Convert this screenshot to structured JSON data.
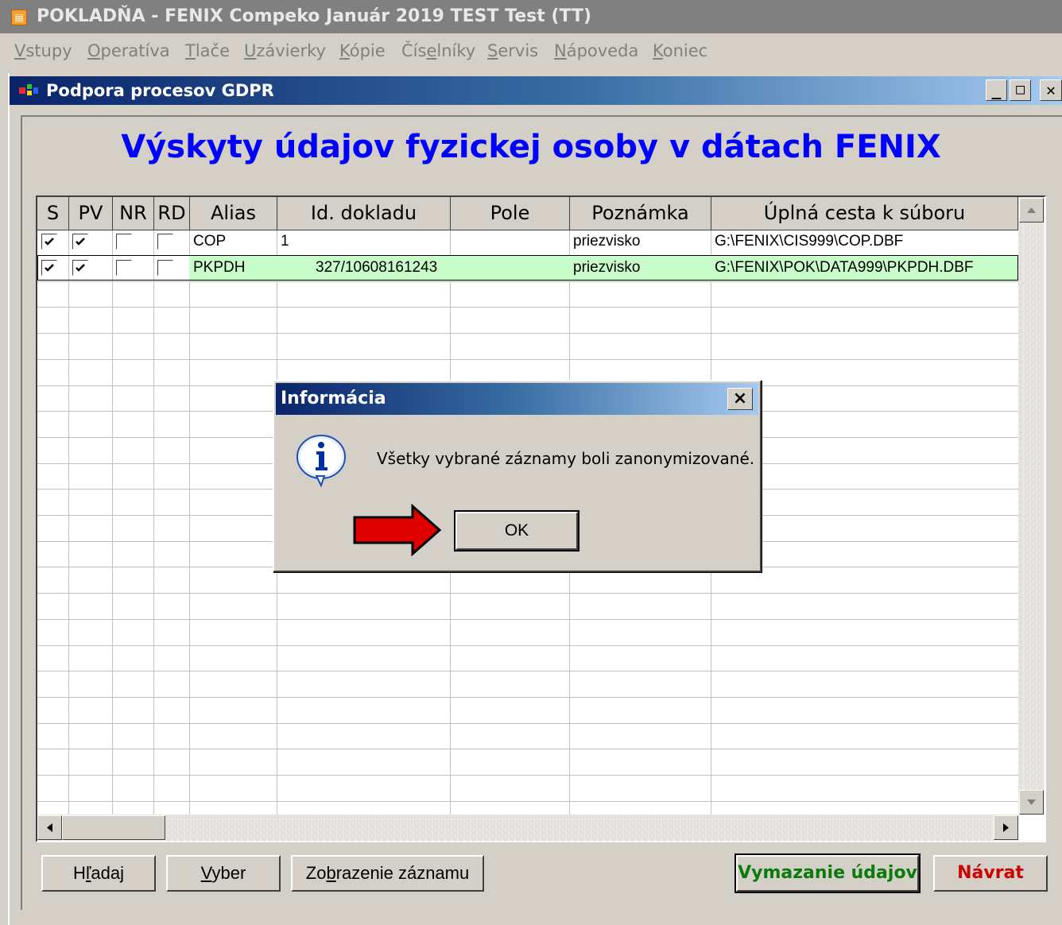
{
  "app": {
    "title": "POKLADŇA - FENIX Compeko  Január 2019  TEST Test  (TT)"
  },
  "menu": {
    "items": [
      {
        "underline": "V",
        "rest": "stupy"
      },
      {
        "underline": "O",
        "rest": "peratíva"
      },
      {
        "underline": "T",
        "rest": "lače"
      },
      {
        "underline": "U",
        "rest": "závierky"
      },
      {
        "underline": "K",
        "rest": "ópie"
      },
      {
        "pre": "Čís",
        "underline": "e",
        "rest": "lníky"
      },
      {
        "underline": "S",
        "rest": "ervis"
      },
      {
        "underline": "N",
        "rest": "ápoveda"
      },
      {
        "underline": "K",
        "rest": "oniec"
      }
    ]
  },
  "window": {
    "title": "Podpora procesov GDPR",
    "heading": "Výskyty údajov fyzickej osoby v dátach FENIX"
  },
  "grid": {
    "columns": [
      "S",
      "PV",
      "NR",
      "RD",
      "Alias",
      "Id. dokladu",
      "Pole",
      "Poznámka",
      "Úplná cesta k súboru"
    ],
    "rows": [
      {
        "s": true,
        "pv": true,
        "nr": false,
        "rd": false,
        "alias": "COP",
        "id": "1",
        "pole": "",
        "poznamka": "priezvisko",
        "cesta": "G:\\FENIX\\CIS999\\COP.DBF"
      },
      {
        "s": true,
        "pv": true,
        "nr": false,
        "rd": false,
        "alias": "PKPDH",
        "id": "327/10608161243",
        "pole": "",
        "poznamka": "priezvisko",
        "cesta": "G:\\FENIX\\POK\\DATA999\\PKPDH.DBF"
      }
    ]
  },
  "buttons": {
    "hladaj": {
      "pre": "H",
      "underline": "ľ",
      "rest": "adaj"
    },
    "vyber": {
      "underline": "V",
      "rest": "yber"
    },
    "zobrazenie": {
      "pre": "Zo",
      "underline": "b",
      "rest": "razenie záznamu"
    },
    "vymazanie": "Vymazanie údajov",
    "navrat": "Návrat"
  },
  "dialog": {
    "title": "Informácia",
    "message": "Všetky vybrané záznamy boli zanonymizované.",
    "ok": "OK",
    "icon": "info-icon",
    "close": "×"
  },
  "colors": {
    "heading": "#0000ff",
    "selected_row": "#c8fcc8",
    "delete_button": "#0a7a0a",
    "return_button": "#cc0000",
    "arrow": "#e00000"
  }
}
